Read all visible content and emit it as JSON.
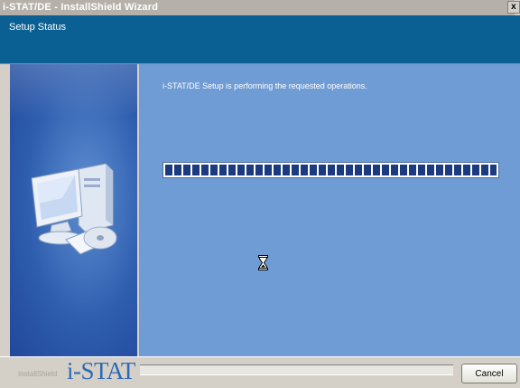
{
  "window": {
    "title": "i-STAT/DE - InstallShield Wizard",
    "close_glyph": "x"
  },
  "header": {
    "title": "Setup Status"
  },
  "left_panel": {
    "illustration": "computer-with-cd-icon"
  },
  "main": {
    "status_text": "i-STAT/DE Setup is performing the requested operations.",
    "progress": {
      "value_percent": 100
    },
    "cursor": "hourglass-icon"
  },
  "footer": {
    "installshield_label": "InstallShield",
    "brand_logo_text": "i-STAT",
    "cancel_label": "Cancel"
  },
  "colors": {
    "header_bg": "#0b6093",
    "main_bg": "#6f9cd4",
    "progress_fill": "#1b3a80",
    "brand": "#2e69b5"
  }
}
